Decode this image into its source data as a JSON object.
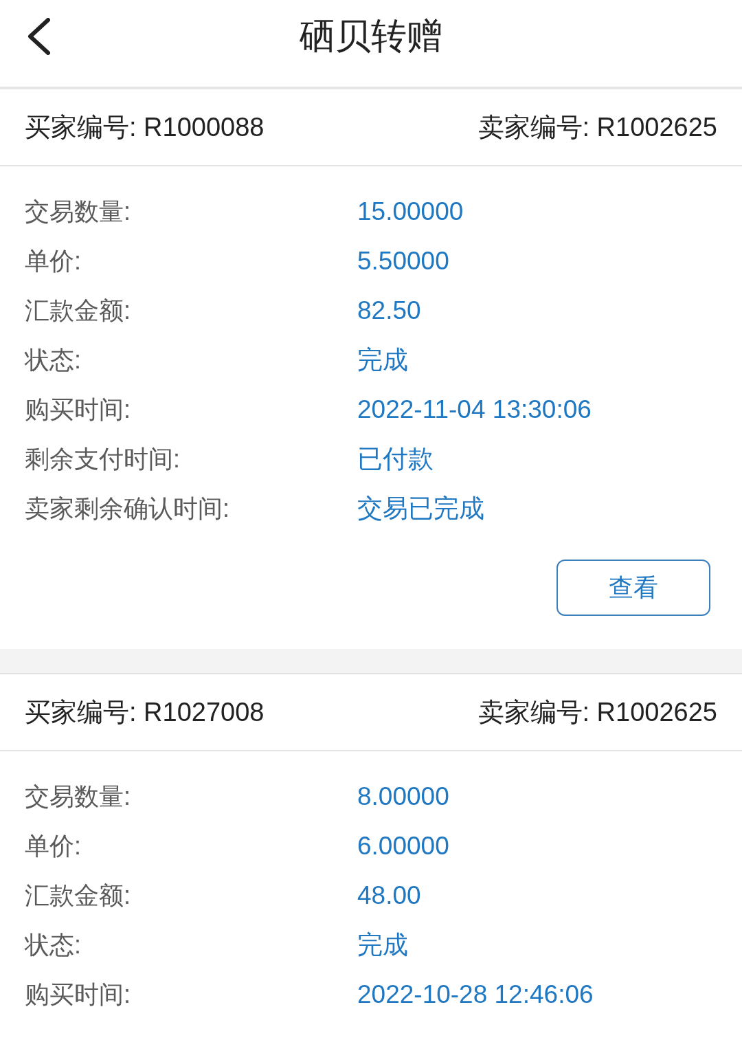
{
  "header": {
    "title": "硒贝转赠"
  },
  "orders": [
    {
      "buyer": "买家编号: R1000088",
      "seller": "卖家编号: R1002625",
      "fields": [
        {
          "label": "交易数量:",
          "value": "15.00000"
        },
        {
          "label": "单价:",
          "value": "5.50000"
        },
        {
          "label": "汇款金额:",
          "value": "82.50"
        },
        {
          "label": "状态:",
          "value": "完成"
        },
        {
          "label": "购买时间:",
          "value": "2022-11-04 13:30:06"
        },
        {
          "label": "剩余支付时间:",
          "value": "已付款"
        },
        {
          "label": "卖家剩余确认时间:",
          "value": "交易已完成"
        }
      ],
      "button": "查看"
    },
    {
      "buyer": "买家编号: R1027008",
      "seller": "卖家编号: R1002625",
      "fields": [
        {
          "label": "交易数量:",
          "value": "8.00000"
        },
        {
          "label": "单价:",
          "value": "6.00000"
        },
        {
          "label": "汇款金额:",
          "value": "48.00"
        },
        {
          "label": "状态:",
          "value": "完成"
        },
        {
          "label": "购买时间:",
          "value": "2022-10-28 12:46:06"
        }
      ]
    }
  ]
}
